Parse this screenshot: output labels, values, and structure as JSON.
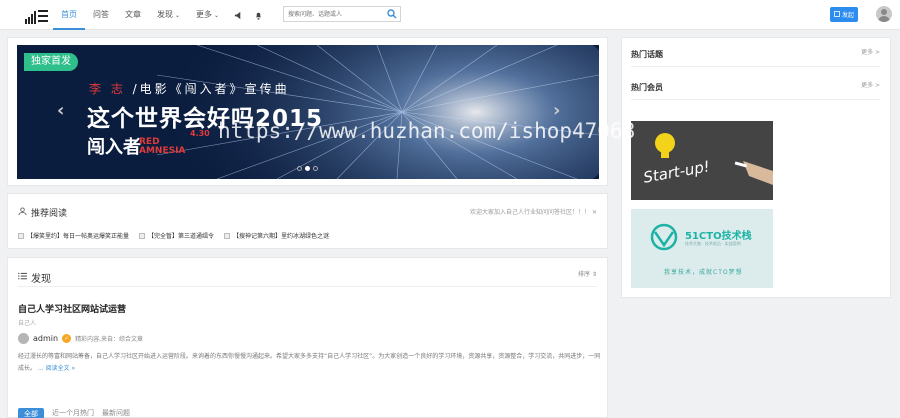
{
  "header": {
    "nav": [
      {
        "label": "首页",
        "active": true
      },
      {
        "label": "问答",
        "active": false
      },
      {
        "label": "文章",
        "active": false
      },
      {
        "label": "发现",
        "active": false,
        "dropdown": true
      },
      {
        "label": "更多",
        "active": false,
        "dropdown": true
      }
    ],
    "icons": [
      "megaphone-icon",
      "bell-icon"
    ],
    "search": {
      "placeholder": "搜索问题、话题或人"
    },
    "launch_label": "发起",
    "accent": "#3b8fd9"
  },
  "banner": {
    "badge": "独家首发",
    "subtitle_red": "李 志",
    "subtitle": " /电影《闯入者》宣传曲",
    "title": "这个世界会好吗2015",
    "logo_cn": "闯入者",
    "logo_en": "RED AMNESIA",
    "release": "4.30",
    "slides": 3,
    "active_slide": 2
  },
  "recommend": {
    "heading": "推荐阅读",
    "note": "欢迎大家加入自己人行业知问问答社区！！！",
    "items": [
      "【爆笑里约】每日一帖奥运爆笑正能量",
      "【完全暂】第三道通缉令",
      "【搜神记第六期】里约冰湖绿色之谜"
    ]
  },
  "feed": {
    "heading": "发现",
    "sort_label": "排序",
    "post": {
      "title": "自己人学习社区网站试运营",
      "tag": "自己人",
      "author": "admin",
      "meta": "精彩内容,来自：综合文章",
      "body": "经过漫长的等富和网站筹备，自己人学习社区开始进入运营阶段。来询着的东西你慢慢沟通起来。希望大家多多支持“自己人学习社区”。为大家创造一个良好的学习环境，资源共享，资源整合，学习交流，共同进步，一同成长。",
      "more": "... 阅读全文 »"
    },
    "tabs": [
      "全部",
      "近一个月热门",
      "最新问题"
    ]
  },
  "sidebar": {
    "hot_topics": "热门话题",
    "hot_members": "热门会员",
    "more": "更多 >",
    "ad1_text": "Start-up!",
    "ad2_title": "51CTO技术栈",
    "ad2_sub": "技术大咖 · 技术前沿 · 实战案例",
    "ad2_slogan": "我享技术，成就CTO梦想"
  },
  "watermark": "https://www.huzhan.com/ishop47068"
}
